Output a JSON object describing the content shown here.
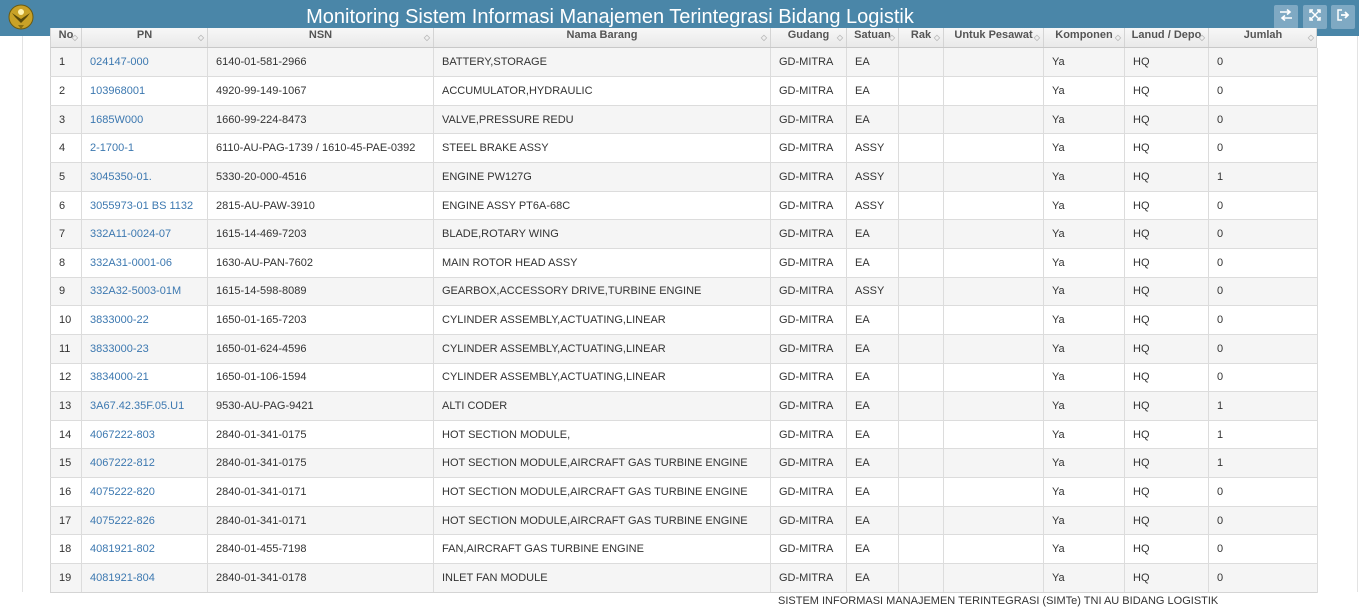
{
  "header": {
    "title": "Monitoring Sistem Informasi Manajemen Terintegrasi Bidang Logistik",
    "logo_icon": "eagle-emblem-icon",
    "buttons": [
      {
        "icon": "swap-arrows-icon"
      },
      {
        "icon": "fullscreen-icon"
      },
      {
        "icon": "logout-icon"
      }
    ]
  },
  "table": {
    "columns": [
      "No",
      "PN",
      "NSN",
      "Nama Barang",
      "Gudang",
      "Satuan",
      "Rak",
      "Untuk Pesawat",
      "Komponen",
      "Lanud / Depo",
      "Jumlah"
    ],
    "rows": [
      [
        "1",
        "024147-000",
        "6140-01-581-2966",
        "BATTERY,STORAGE",
        "GD-MITRA",
        "EA",
        "",
        "",
        "Ya",
        "HQ",
        "0"
      ],
      [
        "2",
        "103968001",
        "4920-99-149-1067",
        "ACCUMULATOR,HYDRAULIC",
        "GD-MITRA",
        "EA",
        "",
        "",
        "Ya",
        "HQ",
        "0"
      ],
      [
        "3",
        "1685W000",
        "1660-99-224-8473",
        "VALVE,PRESSURE REDU",
        "GD-MITRA",
        "EA",
        "",
        "",
        "Ya",
        "HQ",
        "0"
      ],
      [
        "4",
        "2-1700-1",
        "6110-AU-PAG-1739 / 1610-45-PAE-0392",
        "STEEL BRAKE ASSY",
        "GD-MITRA",
        "ASSY",
        "",
        "",
        "Ya",
        "HQ",
        "0"
      ],
      [
        "5",
        "3045350-01.",
        "5330-20-000-4516",
        "ENGINE PW127G",
        "GD-MITRA",
        "ASSY",
        "",
        "",
        "Ya",
        "HQ",
        "1"
      ],
      [
        "6",
        "3055973-01 BS 1132",
        "2815-AU-PAW-3910",
        "ENGINE ASSY PT6A-68C",
        "GD-MITRA",
        "ASSY",
        "",
        "",
        "Ya",
        "HQ",
        "0"
      ],
      [
        "7",
        "332A11-0024-07",
        "1615-14-469-7203",
        "BLADE,ROTARY WING",
        "GD-MITRA",
        "EA",
        "",
        "",
        "Ya",
        "HQ",
        "0"
      ],
      [
        "8",
        "332A31-0001-06",
        "1630-AU-PAN-7602",
        "MAIN ROTOR HEAD ASSY",
        "GD-MITRA",
        "EA",
        "",
        "",
        "Ya",
        "HQ",
        "0"
      ],
      [
        "9",
        "332A32-5003-01M",
        "1615-14-598-8089",
        "GEARBOX,ACCESSORY DRIVE,TURBINE ENGINE",
        "GD-MITRA",
        "ASSY",
        "",
        "",
        "Ya",
        "HQ",
        "0"
      ],
      [
        "10",
        "3833000-22",
        "1650-01-165-7203",
        "CYLINDER ASSEMBLY,ACTUATING,LINEAR",
        "GD-MITRA",
        "EA",
        "",
        "",
        "Ya",
        "HQ",
        "0"
      ],
      [
        "11",
        "3833000-23",
        "1650-01-624-4596",
        "CYLINDER ASSEMBLY,ACTUATING,LINEAR",
        "GD-MITRA",
        "EA",
        "",
        "",
        "Ya",
        "HQ",
        "0"
      ],
      [
        "12",
        "3834000-21",
        "1650-01-106-1594",
        "CYLINDER ASSEMBLY,ACTUATING,LINEAR",
        "GD-MITRA",
        "EA",
        "",
        "",
        "Ya",
        "HQ",
        "0"
      ],
      [
        "13",
        "3A67.42.35F.05.U1",
        "9530-AU-PAG-9421",
        "ALTI CODER",
        "GD-MITRA",
        "EA",
        "",
        "",
        "Ya",
        "HQ",
        "1"
      ],
      [
        "14",
        "4067222-803",
        "2840-01-341-0175",
        "HOT SECTION MODULE,",
        "GD-MITRA",
        "EA",
        "",
        "",
        "Ya",
        "HQ",
        "1"
      ],
      [
        "15",
        "4067222-812",
        "2840-01-341-0175",
        "HOT SECTION MODULE,AIRCRAFT GAS TURBINE ENGINE",
        "GD-MITRA",
        "EA",
        "",
        "",
        "Ya",
        "HQ",
        "1"
      ],
      [
        "16",
        "4075222-820",
        "2840-01-341-0171",
        "HOT SECTION MODULE,AIRCRAFT GAS TURBINE ENGINE",
        "GD-MITRA",
        "EA",
        "",
        "",
        "Ya",
        "HQ",
        "0"
      ],
      [
        "17",
        "4075222-826",
        "2840-01-341-0171",
        "HOT SECTION MODULE,AIRCRAFT GAS TURBINE ENGINE",
        "GD-MITRA",
        "EA",
        "",
        "",
        "Ya",
        "HQ",
        "0"
      ],
      [
        "18",
        "4081921-802",
        "2840-01-455-7198",
        "FAN,AIRCRAFT GAS TURBINE ENGINE",
        "GD-MITRA",
        "EA",
        "",
        "",
        "Ya",
        "HQ",
        "0"
      ],
      [
        "19",
        "4081921-804",
        "2840-01-341-0178",
        "INLET FAN MODULE",
        "GD-MITRA",
        "EA",
        "",
        "",
        "Ya",
        "HQ",
        "0"
      ]
    ]
  },
  "footer": {
    "text": "SISTEM INFORMASI MANAJEMEN TERINTEGRASI (SIMTe) TNI AU BIDANG LOGISTIK"
  },
  "colors": {
    "header_bg": "#4a86a8",
    "link": "#3c78b0"
  }
}
